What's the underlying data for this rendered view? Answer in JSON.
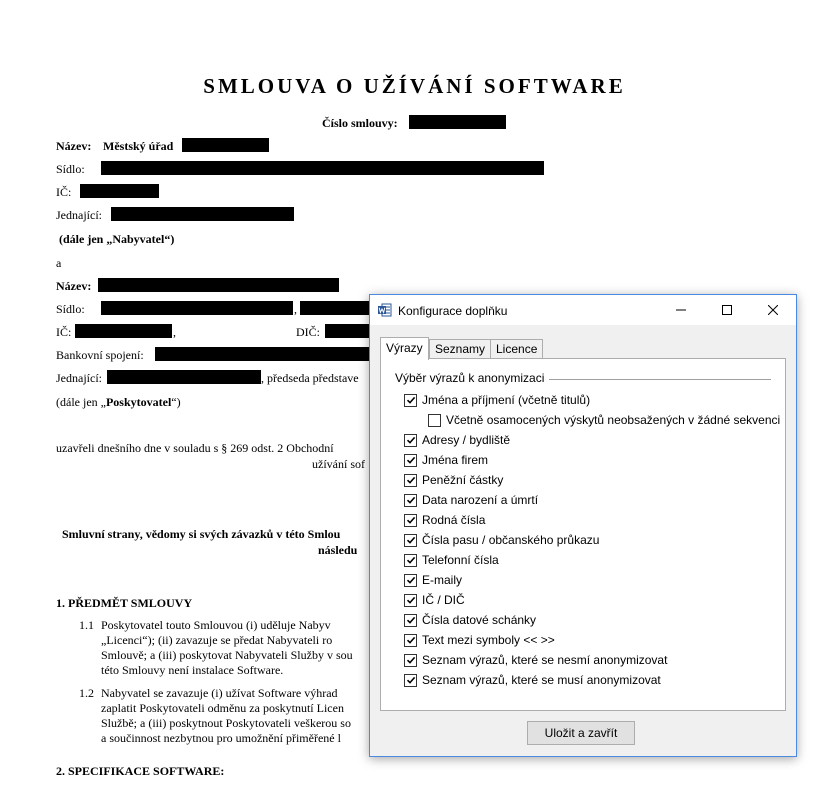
{
  "document": {
    "title": "SMLOUVA O UŽÍVÁNÍ SOFTWARE",
    "contract_number_label": "Číslo smlouvy:",
    "party1": {
      "name_label": "Název:",
      "name_value": "Městský úřad",
      "seat_label": "Sídlo:",
      "ic_label": "IČ:",
      "acting_label": "Jednající:",
      "alias": "(dále jen „Nabyvatel“)"
    },
    "connector": "a",
    "party2": {
      "name_label": "Název:",
      "seat_label": "Sídlo:",
      "seat_comma": ",",
      "ic_label": "IČ:",
      "ic_comma": ",",
      "dic_label": "DIČ:",
      "bank_label": "Bankovní spojení:",
      "acting_label": "Jednající:",
      "acting_suffix": ", předseda představe",
      "alias_prefix": "(dále jen „",
      "alias_name": "Poskytovatel",
      "alias_suffix": "“)"
    },
    "intro_line1": "uzavřeli dnešního dne v souladu s § 269 odst. 2 Obchodní",
    "intro_line2": "užívání sof",
    "parties_line1": "Smluvní strany, vědomy si svých závazků v této Smlou",
    "parties_line2": "následu",
    "section1_heading": "1.   PŘEDMĚT SMLOUVY",
    "s11_num": "1.1",
    "s11_l1": "Poskytovatel touto Smlouvou (i) uděluje Nabyv",
    "s11_l2": "„Licenci“); (ii) zavazuje se předat Nabyvateli ro",
    "s11_l3": "Smlouvě; a (iii) poskytovat Nabyvateli Služby v sou",
    "s11_l4": "této Smlouvy není instalace Software.",
    "s12_num": "1.2",
    "s12_l1": "Nabyvatel se zavazuje (i) užívat Software výhrad",
    "s12_l2": "zaplatit Poskytovateli odměnu za poskytnutí Licen",
    "s12_l3": "Službě; a (iii) poskytnout Poskytovateli veškerou so",
    "s12_l4": "a součinnost nezbytnou pro umožnění přiměřené l",
    "section2_heading": "2.   SPECIFIKACE SOFTWARE:"
  },
  "dialog": {
    "title": "Konfigurace doplňku",
    "app_icon": "word-icon",
    "window_buttons": [
      "minimize-icon",
      "maximize-icon",
      "close-icon"
    ],
    "tabs": [
      {
        "label": "Výrazy",
        "active": true
      },
      {
        "label": "Seznamy",
        "active": false
      },
      {
        "label": "Licence",
        "active": false
      }
    ],
    "group_label": "Výběr výrazů k anonymizaci",
    "options": [
      {
        "label": "Jména a příjmení (včetně titulů)",
        "checked": true,
        "indent": false
      },
      {
        "label": "Včetně osamocených výskytů neobsažených v žádné sekvenci",
        "checked": false,
        "indent": true
      },
      {
        "label": "Adresy / bydliště",
        "checked": true,
        "indent": false
      },
      {
        "label": "Jména firem",
        "checked": true,
        "indent": false
      },
      {
        "label": "Peněžní částky",
        "checked": true,
        "indent": false
      },
      {
        "label": "Data narození a úmrtí",
        "checked": true,
        "indent": false
      },
      {
        "label": "Rodná čísla",
        "checked": true,
        "indent": false
      },
      {
        "label": "Čísla pasu / občanského průkazu",
        "checked": true,
        "indent": false
      },
      {
        "label": "Telefonní čísla",
        "checked": true,
        "indent": false
      },
      {
        "label": "E-maily",
        "checked": true,
        "indent": false
      },
      {
        "label": "IČ / DIČ",
        "checked": true,
        "indent": false
      },
      {
        "label": "Čísla datové schánky",
        "checked": true,
        "indent": false
      },
      {
        "label": "Text mezi symboly  <<  >>",
        "checked": true,
        "indent": false
      },
      {
        "label": "Seznam výrazů, které se nesmí anonymizovat",
        "checked": true,
        "indent": false
      },
      {
        "label": "Seznam výrazů, které se musí anonymizovat",
        "checked": true,
        "indent": false
      }
    ],
    "save_label": "Uložit a zavřít"
  },
  "colors": {
    "dialog_border": "#4a8ae0",
    "word_blue": "#2b579a",
    "redaction": "#000000"
  }
}
